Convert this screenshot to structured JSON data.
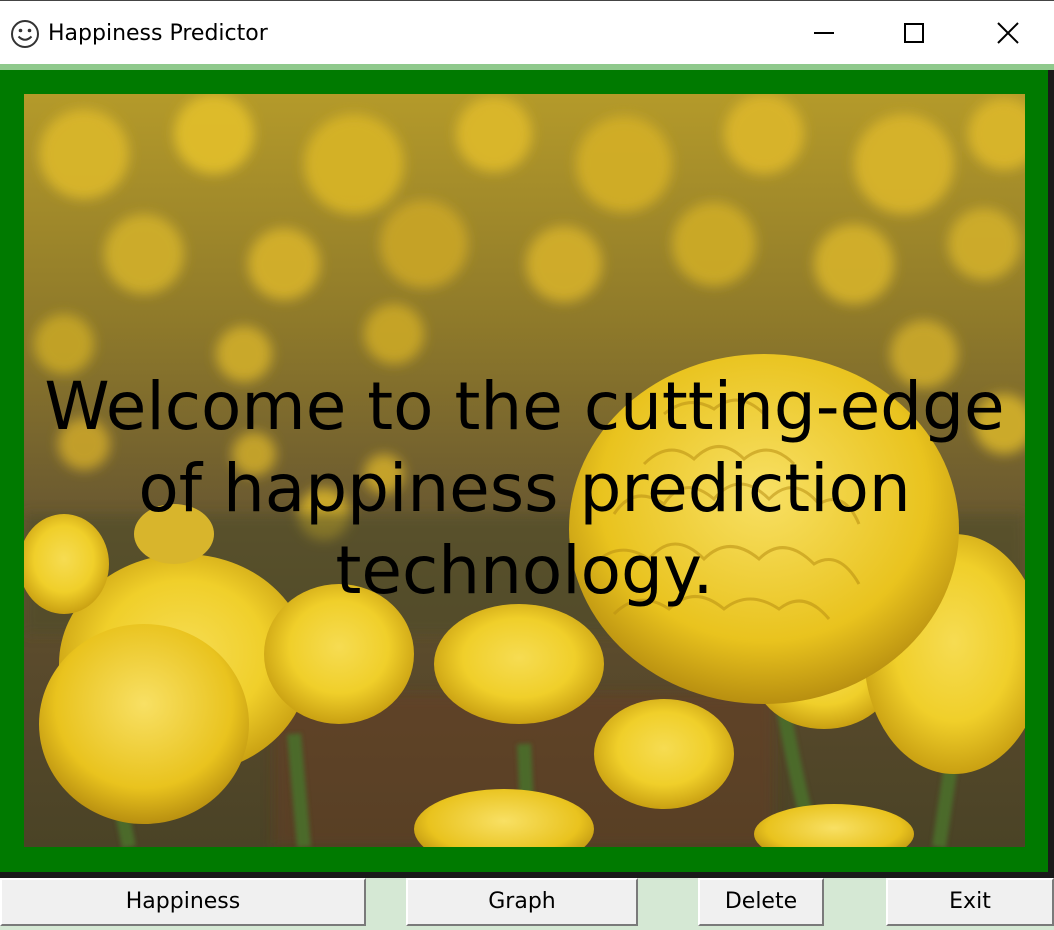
{
  "window": {
    "title": "Happiness Predictor",
    "icon": "smiley-icon",
    "controls": {
      "minimize": "minimize-icon",
      "maximize": "maximize-icon",
      "close": "close-icon"
    }
  },
  "main": {
    "welcome_text": "Welcome to the cutting-edge of happiness prediction technology.",
    "background_image": "yellow-marigold-flowers",
    "frame_color": "#007a00",
    "accent_color": "#d5e8d4"
  },
  "buttons": {
    "happiness": "Happiness",
    "graph": "Graph",
    "delete": "Delete",
    "exit": "Exit"
  }
}
